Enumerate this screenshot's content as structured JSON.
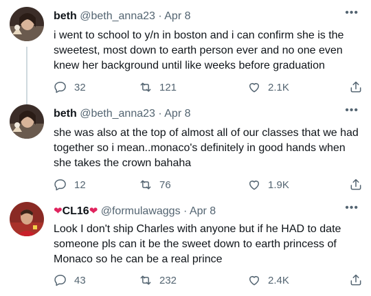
{
  "tweets": [
    {
      "display_name": "beth",
      "handle": "@beth_anna23",
      "separator": " · ",
      "date": "Apr 8",
      "text": "i went to school to y/n in boston and i can confirm she is the sweetest, most down to earth person ever and no one even knew her background until like weeks before graduation",
      "replies": "32",
      "retweets": "121",
      "likes": "2.1K"
    },
    {
      "display_name": "beth",
      "handle": "@beth_anna23",
      "separator": " · ",
      "date": "Apr 8",
      "text": "she was also at the top of almost all of our classes that we had together so i mean..monaco's definitely in good hands when she takes the crown bahaha",
      "replies": "12",
      "retweets": "76",
      "likes": "1.9K"
    },
    {
      "name_prefix": "❤",
      "display_name": "CL16",
      "name_suffix": "❤",
      "handle": "@formulawaggs",
      "separator": " · ",
      "date": "Apr 8",
      "text": "Look I don't ship Charles with anyone but if he HAD to date someone pls can it be the sweet down to earth princess of Monaco so he can be a real prince",
      "replies": "43",
      "retweets": "232",
      "likes": "2.4K"
    }
  ],
  "more_label": "•••",
  "colors": {
    "text": "#0f1419",
    "secondary": "#536471",
    "thread_line": "#cfd9de",
    "heart": "#e0245e"
  }
}
